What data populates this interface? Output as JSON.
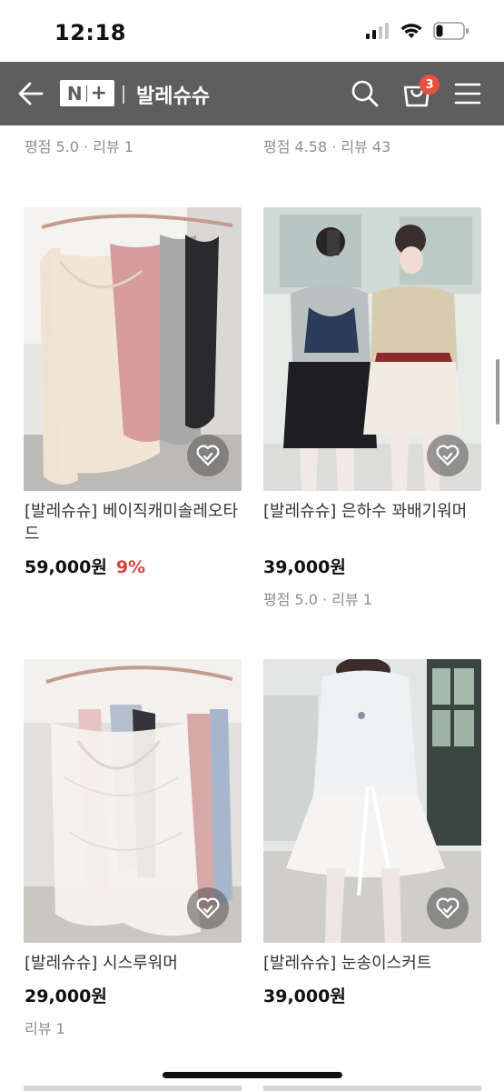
{
  "status": {
    "time": "12:18",
    "battery_level": 0.25
  },
  "header": {
    "logo_n": "N",
    "logo_plus": "+",
    "store_name": "발레슈슈",
    "cart_count": "3"
  },
  "top_ratings": [
    {
      "text": "평점 5.0 · 리뷰 1"
    },
    {
      "text": "평점 4.58 · 리뷰 43"
    }
  ],
  "products": [
    {
      "title": "[발레슈슈] 베이직캐미솔레오타드",
      "price": "59,000원",
      "discount": "9%",
      "meta": "",
      "image": "camisole-leotards-on-hangers"
    },
    {
      "title": "[발레슈슈] 은하수 꽈배기워머",
      "price": "39,000원",
      "discount": "",
      "meta": "평점 5.0 · 리뷰 1",
      "image": "two-dancers-twist-warmers"
    },
    {
      "title": "[발레슈슈] 시스루워머",
      "price": "29,000원",
      "discount": "",
      "meta": "리뷰 1",
      "image": "sheer-lace-warmers-on-hangers"
    },
    {
      "title": "[발레슈슈] 눈송이스커트",
      "price": "39,000원",
      "discount": "",
      "meta": "",
      "image": "dancer-white-skirt-back"
    }
  ],
  "colors": {
    "header_bg": "#5e5e5e",
    "badge": "#e8513d",
    "discount": "#d4453a"
  }
}
